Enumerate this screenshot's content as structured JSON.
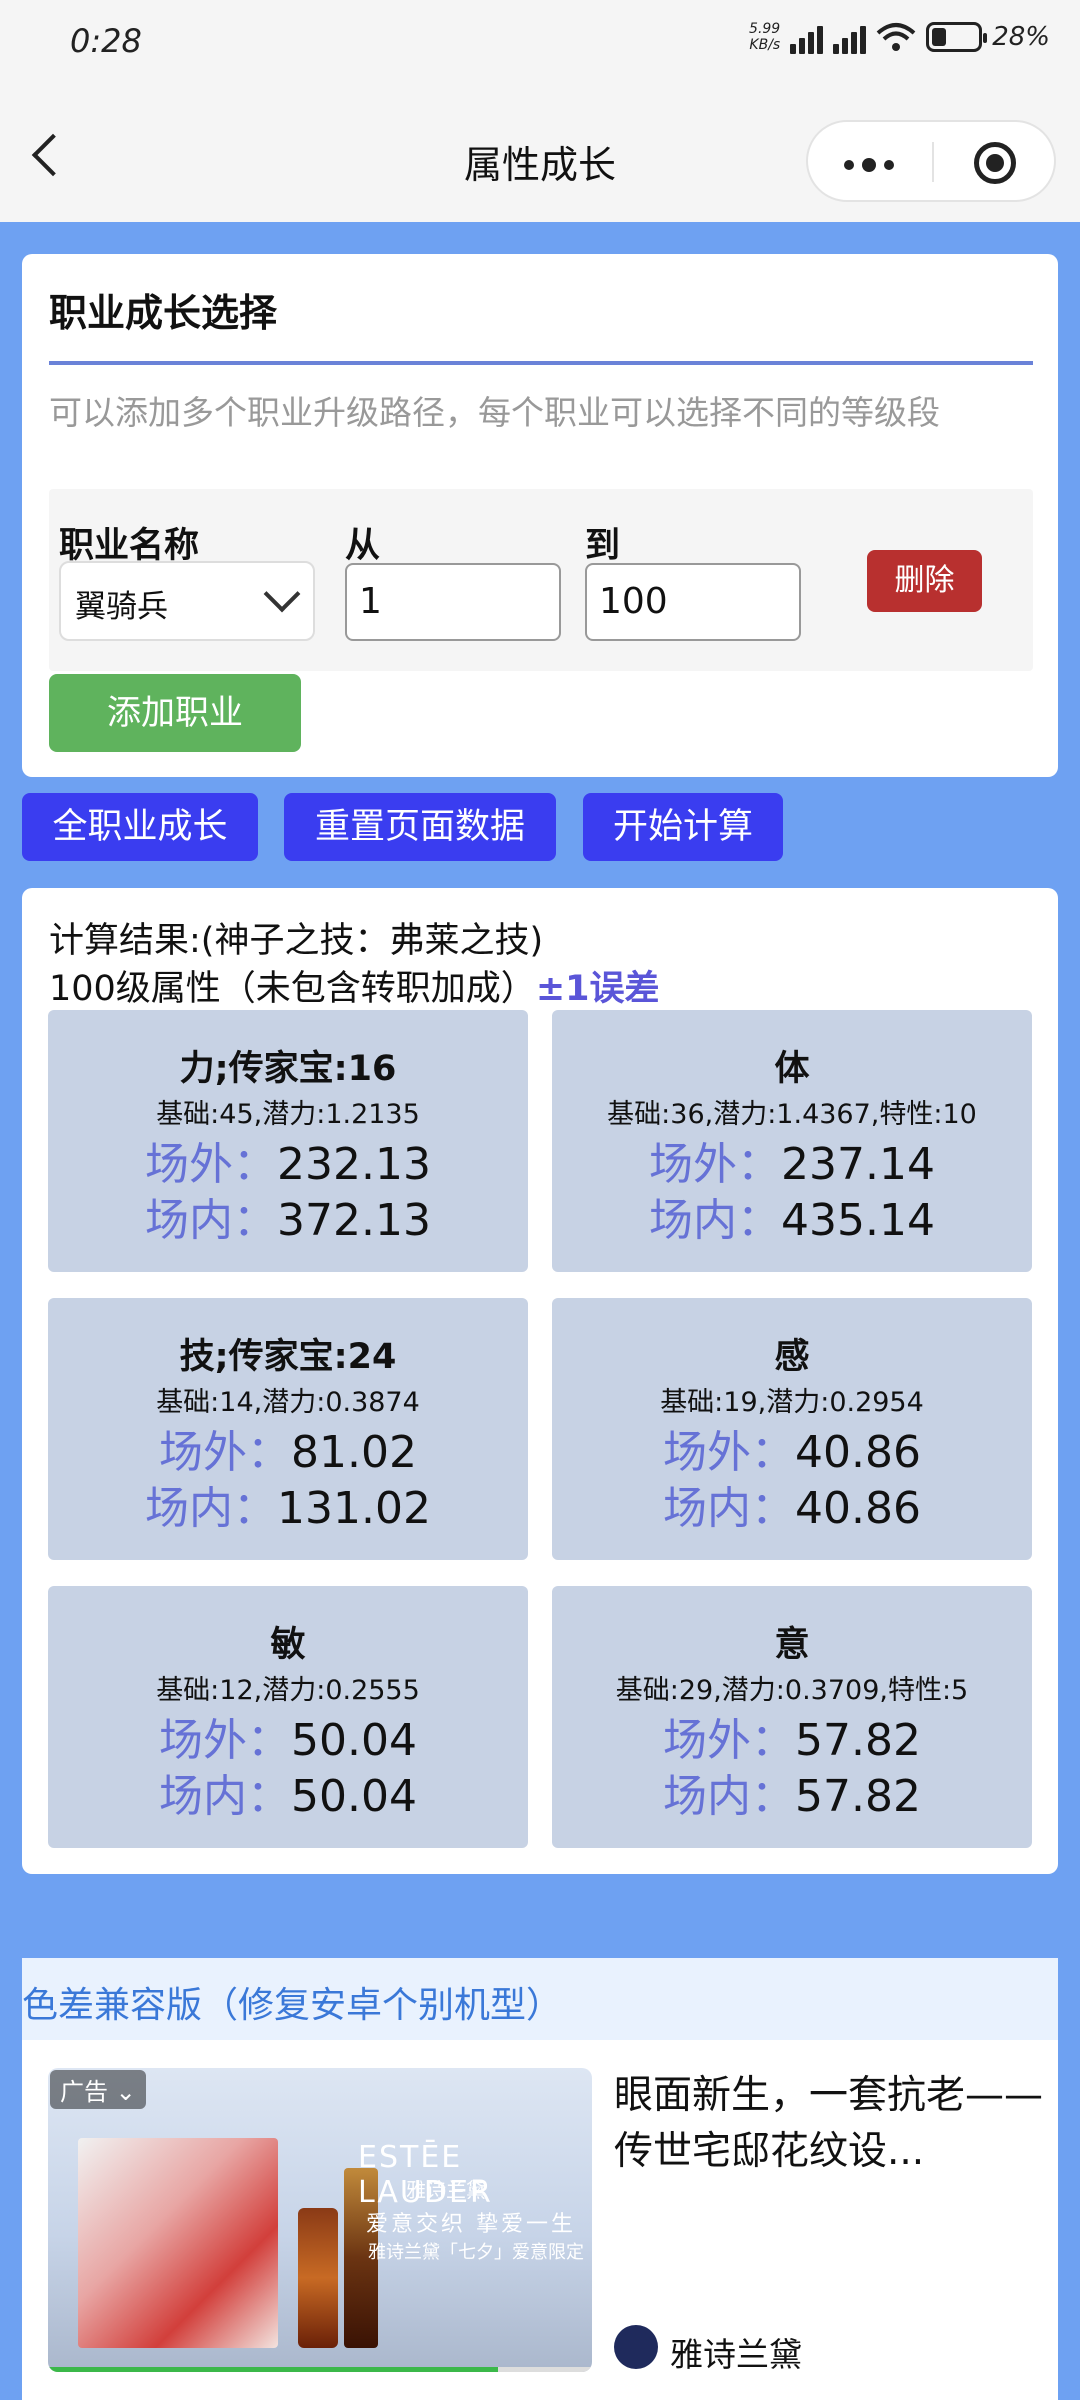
{
  "status": {
    "time": "0:28",
    "net_speed_top": "5.99",
    "net_speed_bottom": "KB/s",
    "battery": "28%"
  },
  "nav": {
    "title": "属性成长"
  },
  "job_card": {
    "title": "职业成长选择",
    "description": "可以添加多个职业升级路径，每个职业可以选择不同的等级段",
    "label_name": "职业名称",
    "label_from": "从",
    "label_to": "到",
    "selected_job": "翼骑兵",
    "from_value": "1",
    "to_value": "100",
    "delete_label": "删除",
    "add_label": "添加职业"
  },
  "actions": {
    "all_jobs": "全职业成长",
    "reset": "重置页面数据",
    "calc": "开始计算"
  },
  "results": {
    "line1": "计算结果:(神子之技：弗莱之技)",
    "line2": "100级属性（未包含转职加成）",
    "error_note": "±1误差",
    "out_label": "场外：",
    "in_label": "场内：",
    "stats": [
      {
        "name": "力;传家宝:16",
        "base": "基础:45,潜力:1.2135",
        "out": "232.13",
        "in": "372.13"
      },
      {
        "name": "体",
        "base": "基础:36,潜力:1.4367,特性:10",
        "out": "237.14",
        "in": "435.14"
      },
      {
        "name": "技;传家宝:24",
        "base": "基础:14,潜力:0.3874",
        "out": "81.02",
        "in": "131.02"
      },
      {
        "name": "感",
        "base": "基础:19,潜力:0.2954",
        "out": "40.86",
        "in": "40.86"
      },
      {
        "name": "敏",
        "base": "基础:12,潜力:0.2555",
        "out": "50.04",
        "in": "50.04"
      },
      {
        "name": "意",
        "base": "基础:29,潜力:0.3709,特性:5",
        "out": "57.82",
        "in": "57.82"
      }
    ]
  },
  "banner": {
    "text": "色差兼容版（修复安卓个别机型）"
  },
  "ad": {
    "tag": "广告 ⌄",
    "brand_en": "ESTĒE LAUDER",
    "brand_cn_small": "雅诗兰黛",
    "slogan": "爱意交织 挚爱一生",
    "slogan2": "雅诗兰黛「七夕」爱意限定",
    "title": "眼面新生，一套抗老——传世宅邸花纹设...",
    "advertiser": "雅诗兰黛",
    "video_progress": 0.828
  }
}
